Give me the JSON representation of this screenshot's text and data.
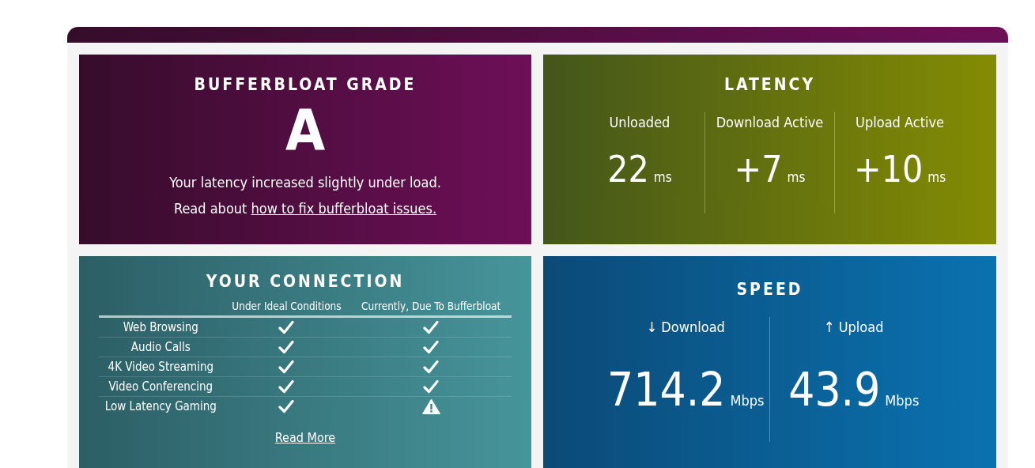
{
  "grade": {
    "title": "BUFFERBLOAT GRADE",
    "grade": "A",
    "message": "Your latency increased slightly under load.",
    "link_prefix": "Read about",
    "link": "how to fix bufferbloat issues."
  },
  "latency": {
    "title": "LATENCY",
    "metrics": [
      {
        "label": "Unloaded",
        "value": "22",
        "unit": "ms"
      },
      {
        "label": "Download Active",
        "value": "+7",
        "unit": "ms"
      },
      {
        "label": "Upload Active",
        "value": "+10",
        "unit": "ms"
      }
    ]
  },
  "connection": {
    "title": "YOUR CONNECTION",
    "columns": [
      "Under Ideal Conditions",
      "Currently, Due To Bufferbloat"
    ],
    "rows": [
      {
        "activity": "Web Browsing",
        "ideal_ok": true,
        "current_ok": true
      },
      {
        "activity": "Audio Calls",
        "ideal_ok": true,
        "current_ok": true
      },
      {
        "activity": "4K Video Streaming",
        "ideal_ok": true,
        "current_ok": true
      },
      {
        "activity": "Video Conferencing",
        "ideal_ok": true,
        "current_ok": true
      },
      {
        "activity": "Low Latency Gaming",
        "ideal_ok": true,
        "current_ok": false
      }
    ],
    "link": "Read More"
  },
  "speed": {
    "title": "SPEED",
    "metrics": [
      {
        "label": "↓ Download",
        "value": "714.2",
        "unit": "Mbps"
      },
      {
        "label": "↑ Upload",
        "value": "43.9",
        "unit": "Mbps"
      }
    ]
  }
}
